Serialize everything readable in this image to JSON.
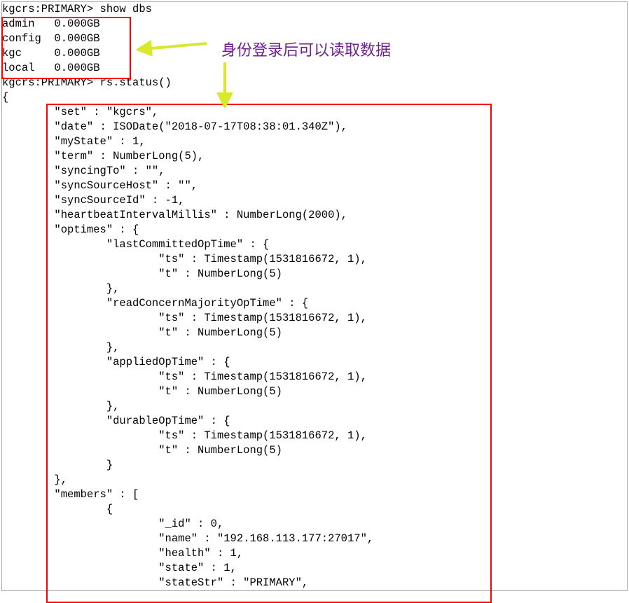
{
  "annotation": "身份登录后可以读取数据",
  "prompt1": "kgcrs:PRIMARY> ",
  "cmd1": "show dbs",
  "db_lines": [
    "admin   0.000GB",
    "config  0.000GB",
    "kgc     0.000GB",
    "local   0.000GB"
  ],
  "prompt2": "kgcrs:PRIMARY> ",
  "cmd2": "rs.status()",
  "status_output": "{\n        \"set\" : \"kgcrs\",\n        \"date\" : ISODate(\"2018-07-17T08:38:01.340Z\"),\n        \"myState\" : 1,\n        \"term\" : NumberLong(5),\n        \"syncingTo\" : \"\",\n        \"syncSourceHost\" : \"\",\n        \"syncSourceId\" : -1,\n        \"heartbeatIntervalMillis\" : NumberLong(2000),\n        \"optimes\" : {\n                \"lastCommittedOpTime\" : {\n                        \"ts\" : Timestamp(1531816672, 1),\n                        \"t\" : NumberLong(5)\n                },\n                \"readConcernMajorityOpTime\" : {\n                        \"ts\" : Timestamp(1531816672, 1),\n                        \"t\" : NumberLong(5)\n                },\n                \"appliedOpTime\" : {\n                        \"ts\" : Timestamp(1531816672, 1),\n                        \"t\" : NumberLong(5)\n                },\n                \"durableOpTime\" : {\n                        \"ts\" : Timestamp(1531816672, 1),\n                        \"t\" : NumberLong(5)\n                }\n        },\n        \"members\" : [\n                {\n                        \"_id\" : 0,\n                        \"name\" : \"192.168.113.177:27017\",\n                        \"health\" : 1,\n                        \"state\" : 1,\n                        \"stateStr\" : \"PRIMARY\","
}
